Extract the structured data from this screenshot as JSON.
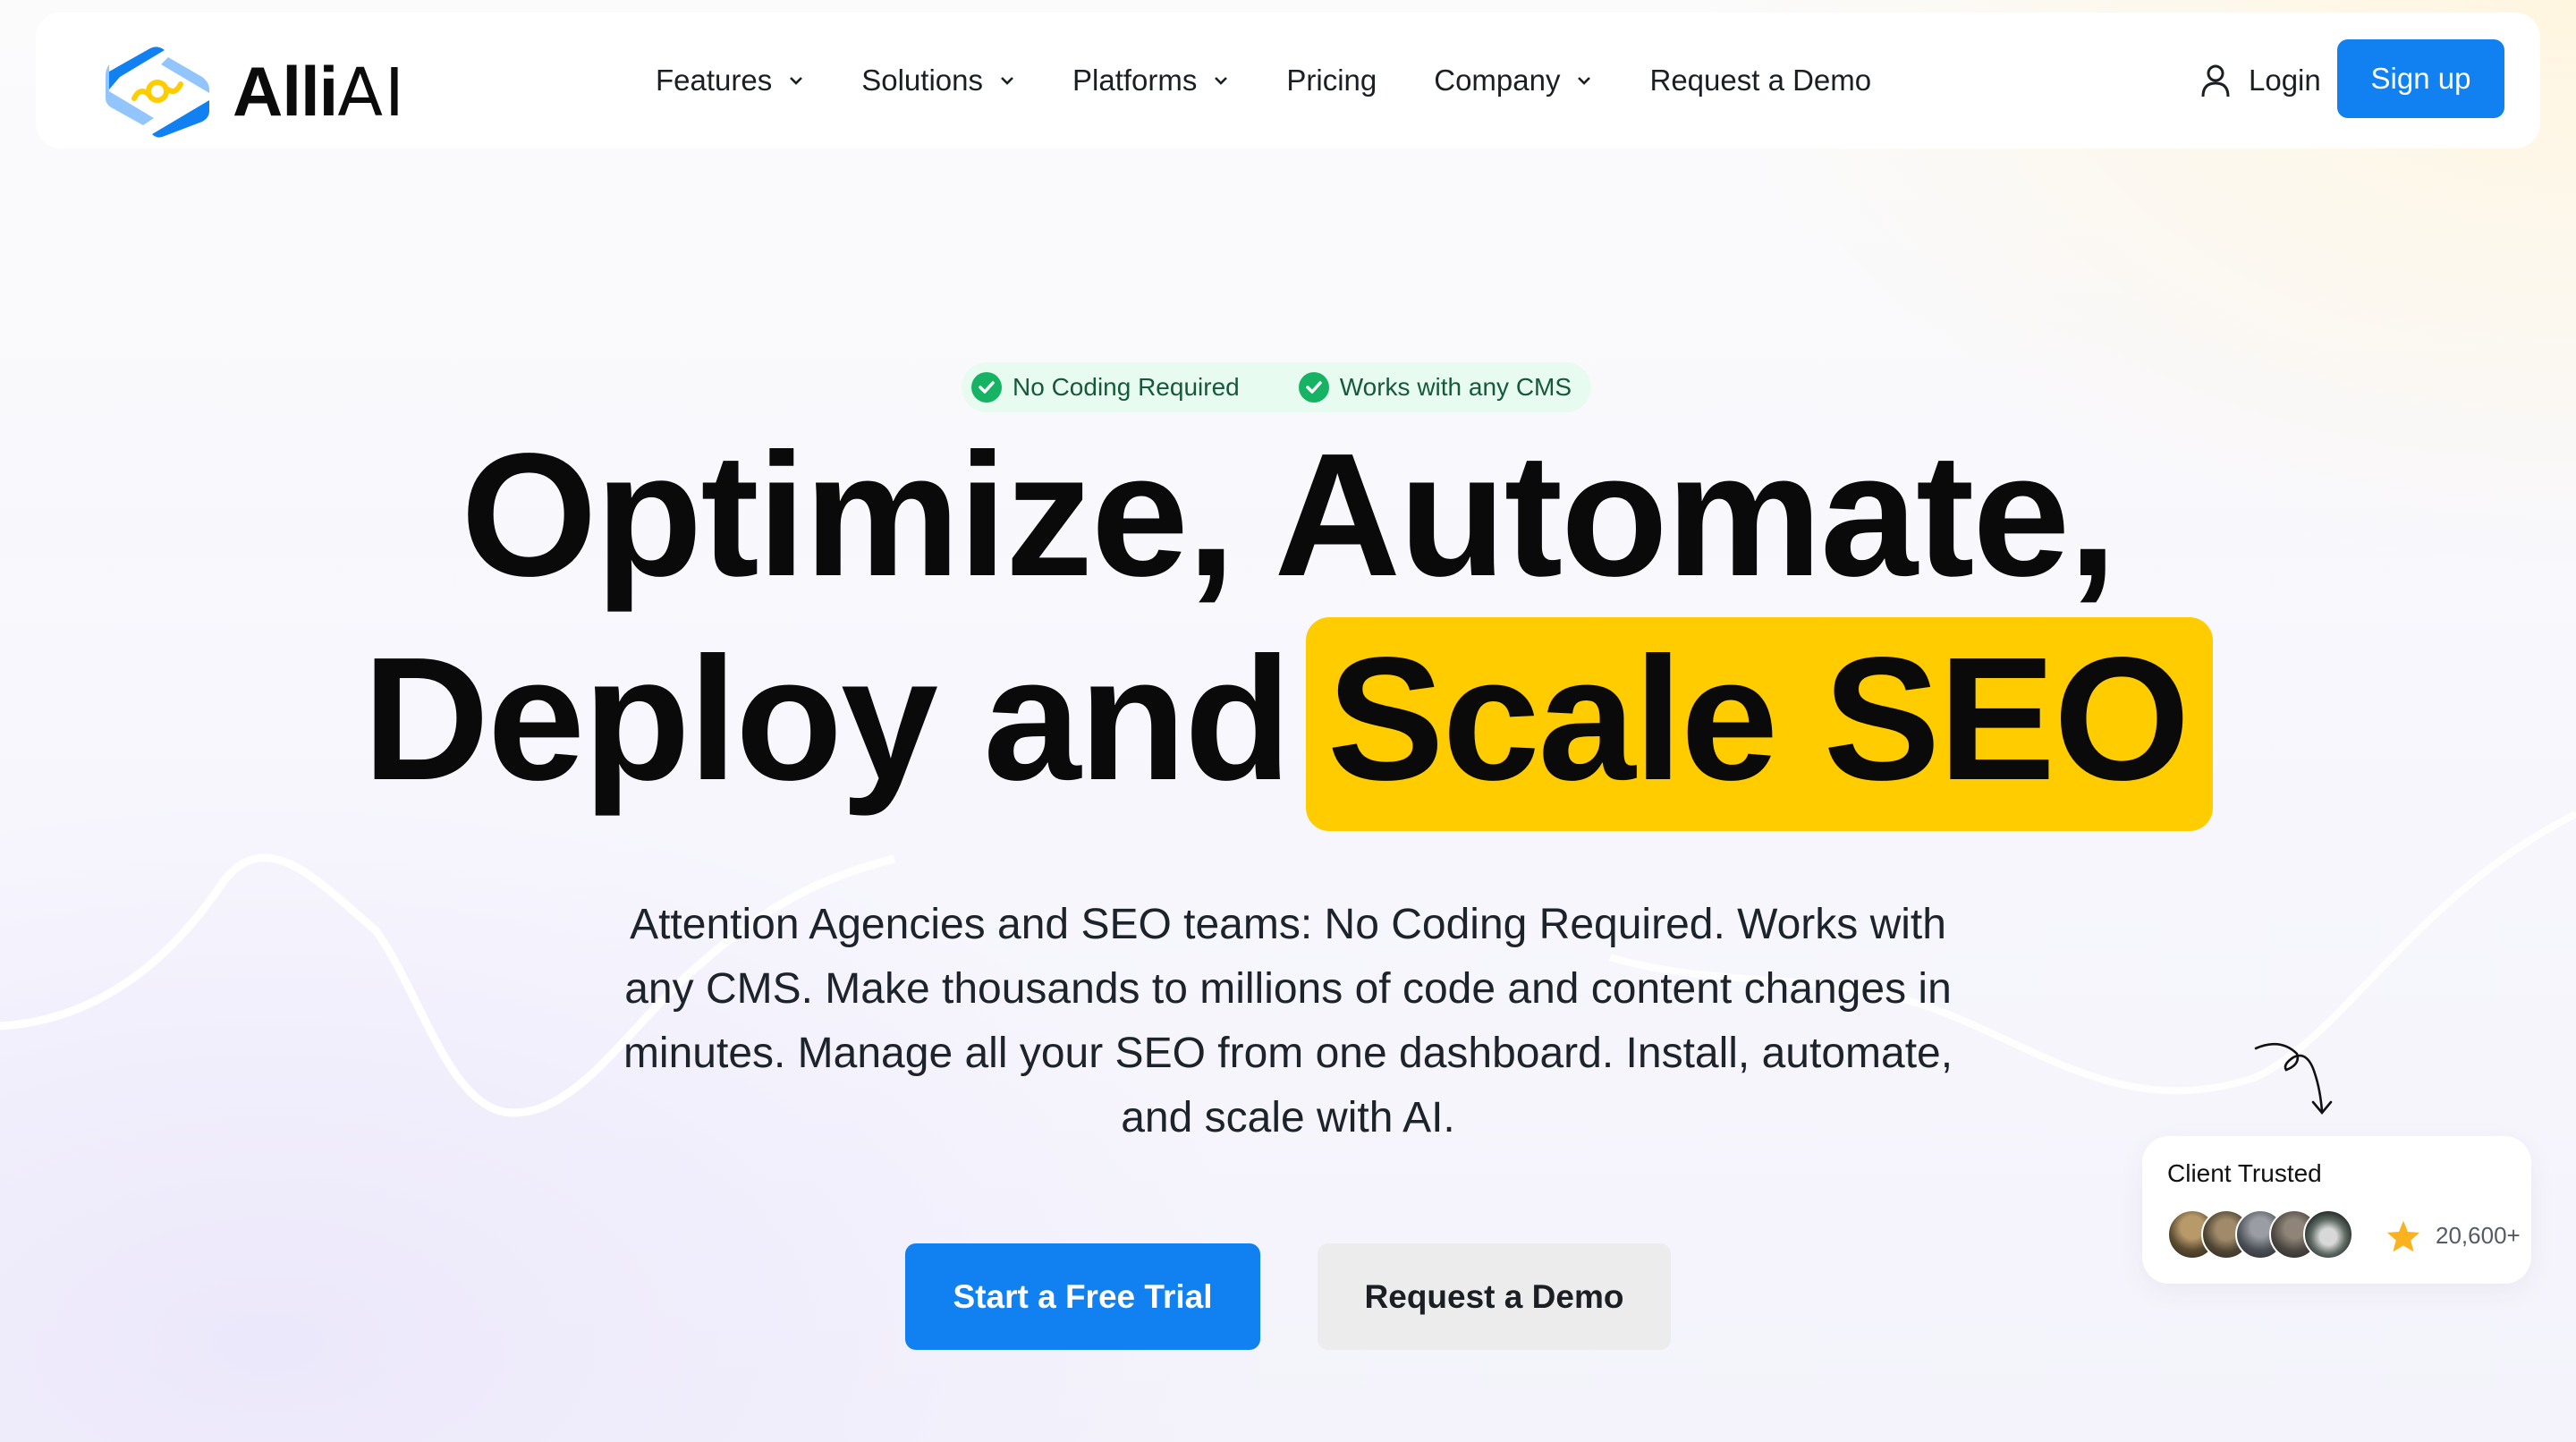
{
  "brand": {
    "name_bold": "Alli",
    "name_light": "AI",
    "colors": {
      "primary": "#1180f0",
      "highlight": "#ffcc00",
      "logo_blue": "#1180f0",
      "logo_light_blue": "#93c5fd",
      "logo_yellow": "#ffcc00",
      "badge_green": "#16b364"
    }
  },
  "nav": {
    "items": [
      {
        "label": "Features",
        "has_dropdown": true
      },
      {
        "label": "Solutions",
        "has_dropdown": true
      },
      {
        "label": "Platforms",
        "has_dropdown": true
      },
      {
        "label": "Pricing",
        "has_dropdown": false
      },
      {
        "label": "Company",
        "has_dropdown": true
      },
      {
        "label": "Request a Demo",
        "has_dropdown": false
      }
    ],
    "login_label": "Login",
    "login_icon": "user-icon",
    "signup_label": "Sign up"
  },
  "hero": {
    "badges": [
      {
        "icon": "check-circle-icon",
        "label": "No Coding Required"
      },
      {
        "icon": "check-circle-icon",
        "label": "Works with any CMS"
      }
    ],
    "headline_line1": "Optimize, Automate,",
    "headline_line2_plain": "Deploy and",
    "headline_line2_highlight": "Scale SEO",
    "description": "Attention Agencies and SEO teams: No Coding Required. Works with any CMS. Make thousands to millions of code and content changes in minutes. Manage all your SEO from one dashboard. Install, automate, and scale with AI.",
    "cta_primary": "Start a Free Trial",
    "cta_secondary": "Request a Demo"
  },
  "client_card": {
    "title": "Client Trusted",
    "avatar_count": 5,
    "rating_icon": "star-icon",
    "count": "20,600+"
  }
}
